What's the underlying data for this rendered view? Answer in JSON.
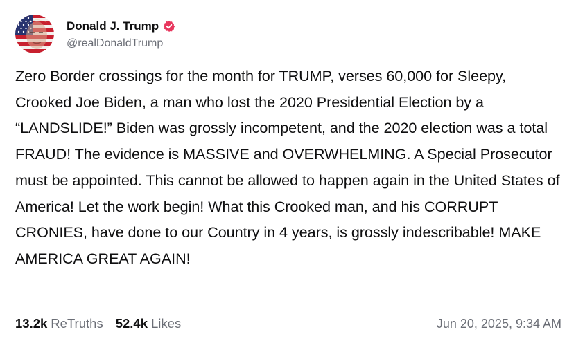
{
  "author": {
    "display_name": "Donald J. Trump",
    "handle": "@realDonaldTrump",
    "verified": true,
    "verified_color": "#e8365d",
    "avatar_icon": "flag-portrait-avatar"
  },
  "post": {
    "text": "Zero Border crossings for the month for TRUMP, verses 60,000 for Sleepy, Crooked Joe Biden, a man who lost the 2020 Presidential Election by a “LANDSLIDE!” Biden was grossly incompetent, and the 2020 election was a total FRAUD! The evidence is MASSIVE and OVERWHELMING. A Special Prosecutor must be appointed. This cannot be allowed to happen again in the United States of America! Let the work begin! What this Crooked man, and his CORRUPT CRONIES, have done to our Country in 4 years, is grossly indescribable! MAKE AMERICA GREAT AGAIN!"
  },
  "stats": {
    "retruths_count": "13.2k",
    "retruths_label": "ReTruths",
    "likes_count": "52.4k",
    "likes_label": "Likes"
  },
  "timestamp": "Jun 20, 2025, 9:34 AM",
  "colors": {
    "text_primary": "#0f0f10",
    "text_secondary": "#6b6e76"
  }
}
